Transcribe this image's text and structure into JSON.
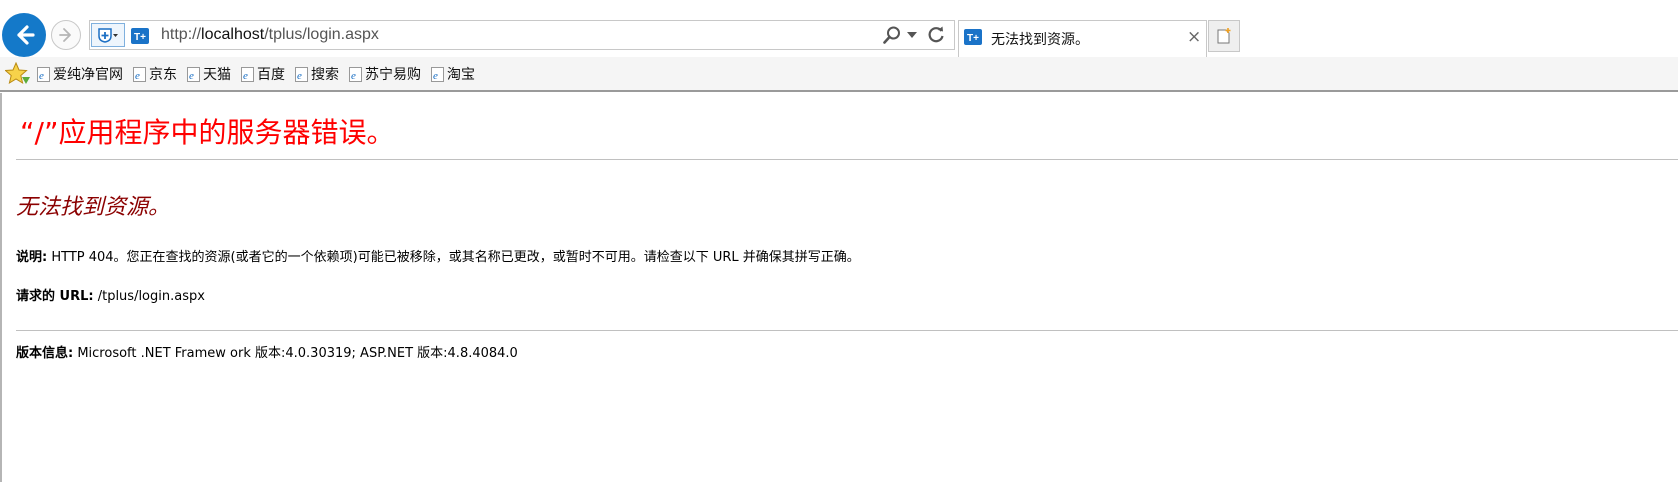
{
  "browser": {
    "address_url_prefix": "http://",
    "address_url_host": "localhost",
    "address_url_path": "/tplus/login.aspx",
    "tab_title": "无法找到资源。",
    "tab_close": "×",
    "icons": {
      "back": "back-arrow-icon",
      "forward": "forward-arrow-icon",
      "compat": "shield-icon",
      "site": "tplus-site-icon",
      "search": "search-icon",
      "refresh": "refresh-icon",
      "new_tab": "new-tab-icon",
      "favorites": "favorites-star-icon"
    },
    "colors": {
      "back_button": "#1479c9",
      "title_red": "#ff0000",
      "subtitle_darkred": "#8b0000"
    }
  },
  "favorites": [
    {
      "label": "爱纯净官网"
    },
    {
      "label": "京东"
    },
    {
      "label": "天猫"
    },
    {
      "label": "百度"
    },
    {
      "label": "搜索"
    },
    {
      "label": "苏宁易购"
    },
    {
      "label": "淘宝"
    }
  ],
  "page": {
    "title": "“/”应用程序中的服务器错误。",
    "subtitle": "无法找到资源。",
    "description_label": "说明:",
    "description_text": " HTTP 404。您正在查找的资源(或者它的一个依赖项)可能已被移除，或其名称已更改，或暂时不可用。请检查以下 URL 并确保其拼写正确。",
    "requested_url_label": "请求的  URL:",
    "requested_url_value": " /tplus/login.aspx",
    "version_label": "版本信息:",
    "version_text": " Microsoft .NET Framew ork 版本:4.0.30319; ASP.NET 版本:4.8.4084.0"
  }
}
